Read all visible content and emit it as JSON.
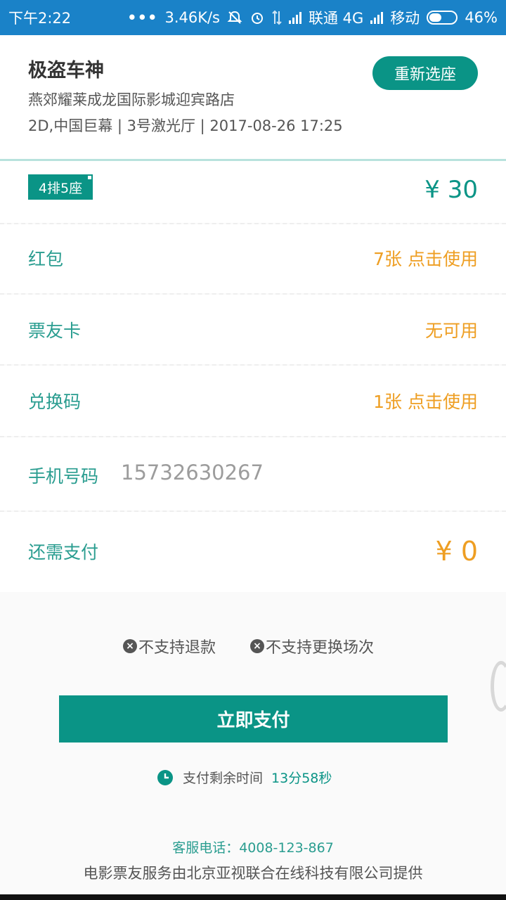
{
  "status_bar": {
    "time": "下午2:22",
    "dots": "•••",
    "speed": "3.46K/s",
    "carrier1": "联通 4G",
    "carrier2": "移动",
    "battery": "46%",
    "battery_level": 0.46
  },
  "movie": {
    "title": "极盗车神",
    "cinema": "燕郊耀莱成龙国际影城迎宾路店",
    "info": "2D,中国巨幕 | 3号激光厅 | 2017-08-26 17:25",
    "reselect_label": "重新选座"
  },
  "order": {
    "seat": "4排5座",
    "price": "¥ 30",
    "red_packet_label": "红包",
    "red_packet_value": "7张 点击使用",
    "card_label": "票友卡",
    "card_value": "无可用",
    "code_label": "兑换码",
    "code_value": "1张 点击使用",
    "phone_label": "手机号码",
    "phone_value": "15732630267",
    "need_pay_label": "还需支付",
    "need_pay_value": "¥ 0"
  },
  "notices": {
    "no_refund": "不支持退款",
    "no_change": "不支持更换场次"
  },
  "pay_button": "立即支付",
  "timer": {
    "label": "支付剩余时间",
    "remaining": "13分58秒"
  },
  "footer": {
    "service_phone": "客服电话：4008-123-867",
    "provider": "电影票友服务由北京亚视联合在线科技有限公司提供"
  },
  "colors": {
    "accent": "#0a9486",
    "warning": "#ee9e22",
    "status_bar": "#1a82c8"
  }
}
